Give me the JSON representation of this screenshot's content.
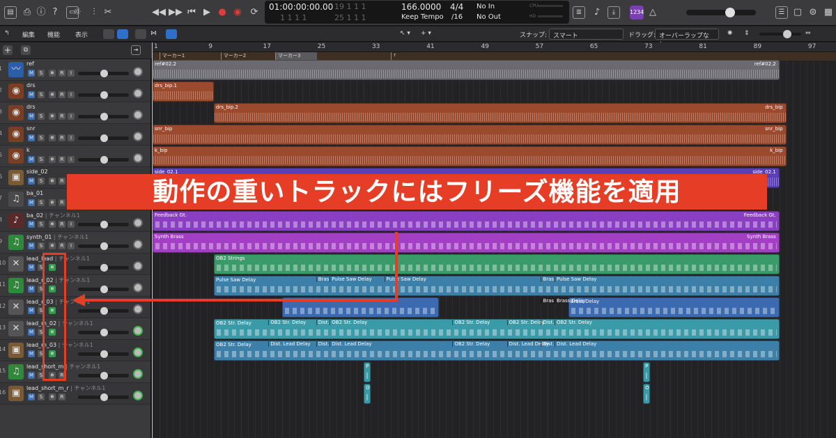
{
  "transport": {
    "time_code": "01:00:00:00.00",
    "time_code_sub": "1 1 1 1",
    "position_bar": "19 1 1 1",
    "position_bar_sub": "25 1 1 1",
    "tempo": "166.0000",
    "tempo_mode": "Keep Tempo",
    "signature_top": "4/4",
    "signature_bottom": "/16",
    "input": "No In",
    "output": "No Out",
    "cpu_label": "CPU",
    "hd_label": "HD",
    "count_in": "1234"
  },
  "toolbar": {
    "edit_menu": "編集",
    "functions_menu": "機能",
    "view_menu": "表示",
    "snap_label": "スナップ:",
    "snap_value": "スマート",
    "drag_label": "ドラッグ:",
    "drag_value": "オーバーラップなし"
  },
  "ruler": {
    "bars": [
      "1",
      "9",
      "17",
      "25",
      "33",
      "41",
      "49",
      "57",
      "65",
      "73",
      "81",
      "89",
      "97"
    ]
  },
  "markers": [
    "マーカー1",
    "マーカー2",
    "マーカー3",
    "r"
  ],
  "tracks": [
    {
      "num": "1",
      "name": "ref",
      "channel": "",
      "icon": "waveform-icon",
      "m": "M",
      "s": "S",
      "f": "❄",
      "r": "R",
      "i": "I"
    },
    {
      "num": "2",
      "name": "drs",
      "channel": "",
      "icon": "drum-icon",
      "m": "M",
      "s": "S",
      "f": "❄",
      "r": "R",
      "i": "I"
    },
    {
      "num": "3",
      "name": "drs",
      "channel": "",
      "icon": "drum-icon",
      "m": "M",
      "s": "S",
      "f": "❄",
      "r": "R",
      "i": "I"
    },
    {
      "num": "4",
      "name": "snr",
      "channel": "",
      "icon": "drum-icon",
      "m": "M",
      "s": "S",
      "f": "❄",
      "r": "R",
      "i": "I"
    },
    {
      "num": "5",
      "name": "k",
      "channel": "",
      "icon": "drum-icon",
      "m": "M",
      "s": "S",
      "f": "❄",
      "r": "R",
      "i": "I"
    },
    {
      "num": "6",
      "name": "side_02",
      "channel": "",
      "icon": "amp-icon",
      "m": "M",
      "s": "S",
      "f": "❄",
      "r": "R",
      "i": "I"
    },
    {
      "num": "7",
      "name": "ba_01",
      "channel": "",
      "icon": "bass-icon",
      "m": "M",
      "s": "S",
      "f": "❄",
      "r": "R",
      "i": "I"
    },
    {
      "num": "8",
      "name": "ba_02",
      "channel": "チャンネル1",
      "icon": "guitar-icon",
      "m": "M",
      "s": "S",
      "f": "❄",
      "r": "R",
      "i": "I"
    },
    {
      "num": "9",
      "name": "synth_01",
      "channel": "チャンネル1",
      "icon": "note-icon",
      "m": "M",
      "s": "S",
      "f": "❄",
      "r": "R",
      "i": "I"
    },
    {
      "num": "10",
      "name": "lead_lead",
      "channel": "チャンネル1",
      "icon": "keyboard-stand-icon",
      "m": "M",
      "s": "S",
      "f": "❄",
      "r": "",
      "i": ""
    },
    {
      "num": "11",
      "name": "lead_r_02",
      "channel": "チャンネル1",
      "icon": "note-icon",
      "m": "M",
      "s": "S",
      "f": "❄",
      "r": "",
      "i": ""
    },
    {
      "num": "12",
      "name": "lead_r_03",
      "channel": "チャンネル1",
      "icon": "keyboard-stand-icon",
      "m": "M",
      "s": "S",
      "f": "❄",
      "r": "",
      "i": ""
    },
    {
      "num": "13",
      "name": "lead_m_02",
      "channel": "チャンネル1",
      "icon": "keyboard-stand-icon",
      "m": "M",
      "s": "S",
      "f": "❄",
      "r": "",
      "i": ""
    },
    {
      "num": "14",
      "name": "lead_m_03",
      "channel": "チャンネル1",
      "icon": "amp-icon",
      "m": "M",
      "s": "S",
      "f": "❄",
      "r": "",
      "i": ""
    },
    {
      "num": "15",
      "name": "lead_short_m",
      "channel": "チャンネル1",
      "icon": "note-icon",
      "m": "M",
      "s": "S",
      "f": "❄",
      "r": "R",
      "i": ""
    },
    {
      "num": "16",
      "name": "lead_short_m_r",
      "channel": "チャンネル1",
      "icon": "amp-icon",
      "m": "M",
      "s": "S",
      "f": "❄",
      "r": "R",
      "i": ""
    }
  ],
  "regions": [
    {
      "track": 0,
      "start": 1,
      "end": 93,
      "label": "ref#02.2",
      "label_r": "ref#02.2",
      "color": "#6a6a70",
      "kind": "audio"
    },
    {
      "track": 1,
      "start": 1,
      "end": 10,
      "label": "drs_bip.1",
      "label_r": "",
      "color": "#9b4a2e",
      "kind": "audio"
    },
    {
      "track": 2,
      "start": 10,
      "end": 94,
      "label": "drs_bip.2",
      "label_r": "drs_bip",
      "color": "#9b4a2e",
      "kind": "audio"
    },
    {
      "track": 3,
      "start": 1,
      "end": 94,
      "label": "snr_bip",
      "label_r": "snr_bip",
      "color": "#9b4a2e",
      "kind": "audio"
    },
    {
      "track": 4,
      "start": 1,
      "end": 94,
      "label": "k_bip",
      "label_r": "k_bip",
      "color": "#9b4a2e",
      "kind": "audio"
    },
    {
      "track": 5,
      "start": 1,
      "end": 93,
      "label": "side_02.1",
      "label_r": "side_02.1",
      "color": "#5b3fb6",
      "kind": "audio"
    },
    {
      "track": 7,
      "start": 1,
      "end": 93,
      "label": "Feedback Gt.",
      "label_r": "Feedback Gt.",
      "color": "#8a3fc2",
      "kind": "midi"
    },
    {
      "track": 8,
      "start": 1,
      "end": 93,
      "label": "Synth Brass",
      "label_r": "Synth Brass",
      "color": "#a23fc4",
      "kind": "midi"
    },
    {
      "track": 9,
      "start": 10,
      "end": 93,
      "label": "OB2 Strings",
      "label_r": "",
      "color": "#3a9a6a",
      "kind": "midi"
    },
    {
      "track": 10,
      "start": 10,
      "end": 93,
      "label": "Pulse Saw Delay",
      "label_r": "",
      "color": "#3c7fa8",
      "kind": "midi"
    },
    {
      "track": 11,
      "start": 20,
      "end": 43,
      "label": "",
      "label_r": "",
      "color": "#3c6ab0",
      "kind": "midi"
    },
    {
      "track": 11,
      "start": 62,
      "end": 93,
      "label": "Brass Delay",
      "label_r": "",
      "color": "#3c6ab0",
      "kind": "midi"
    },
    {
      "track": 12,
      "start": 10,
      "end": 93,
      "label": "OB2 Str. Delay",
      "label_r": "",
      "color": "#3a9aa8",
      "kind": "midi"
    },
    {
      "track": 13,
      "start": 10,
      "end": 93,
      "label": "OB2 Str. Delay",
      "label_r": "",
      "color": "#3c7fa8",
      "kind": "midi"
    },
    {
      "track": 14,
      "start": 32,
      "end": 33,
      "label": "P",
      "label_r": "",
      "color": "#3a9aa8",
      "kind": "midi"
    },
    {
      "track": 14,
      "start": 73,
      "end": 74,
      "label": "P",
      "label_r": "",
      "color": "#3a9aa8",
      "kind": "midi"
    },
    {
      "track": 15,
      "start": 32,
      "end": 33,
      "label": "O",
      "label_r": "",
      "color": "#3a9aa8",
      "kind": "midi"
    },
    {
      "track": 15,
      "start": 73,
      "end": 74,
      "label": "O",
      "label_r": "",
      "color": "#3a9aa8",
      "kind": "midi"
    }
  ],
  "region_sub_labels": {
    "pulse_row": [
      "Bras",
      "Pulse Saw Delay",
      "Pulse Saw Delay",
      "Bras",
      "Pulse Saw Delay"
    ],
    "brass_row": [
      "Bras",
      "Brass Delay"
    ],
    "ob2_row": [
      "OB2 Str. Delay",
      "Dist.",
      "OB2 Str. Delay",
      "OB2 Str. Delay",
      "OB2 Str. Delay",
      "Dist.",
      "OB2 Str. Delay"
    ],
    "dist_row": [
      "Dist. Lead Delay",
      "Dist.",
      "Dist. Lead Delay",
      "OB2 Str. Delay",
      "Dist. Lead Delay",
      "Dist.",
      "Dist. Lead Delay"
    ]
  },
  "banner": {
    "text": "動作の重いトラックにはフリーズ機能を適用",
    "color": "#e63e26"
  }
}
